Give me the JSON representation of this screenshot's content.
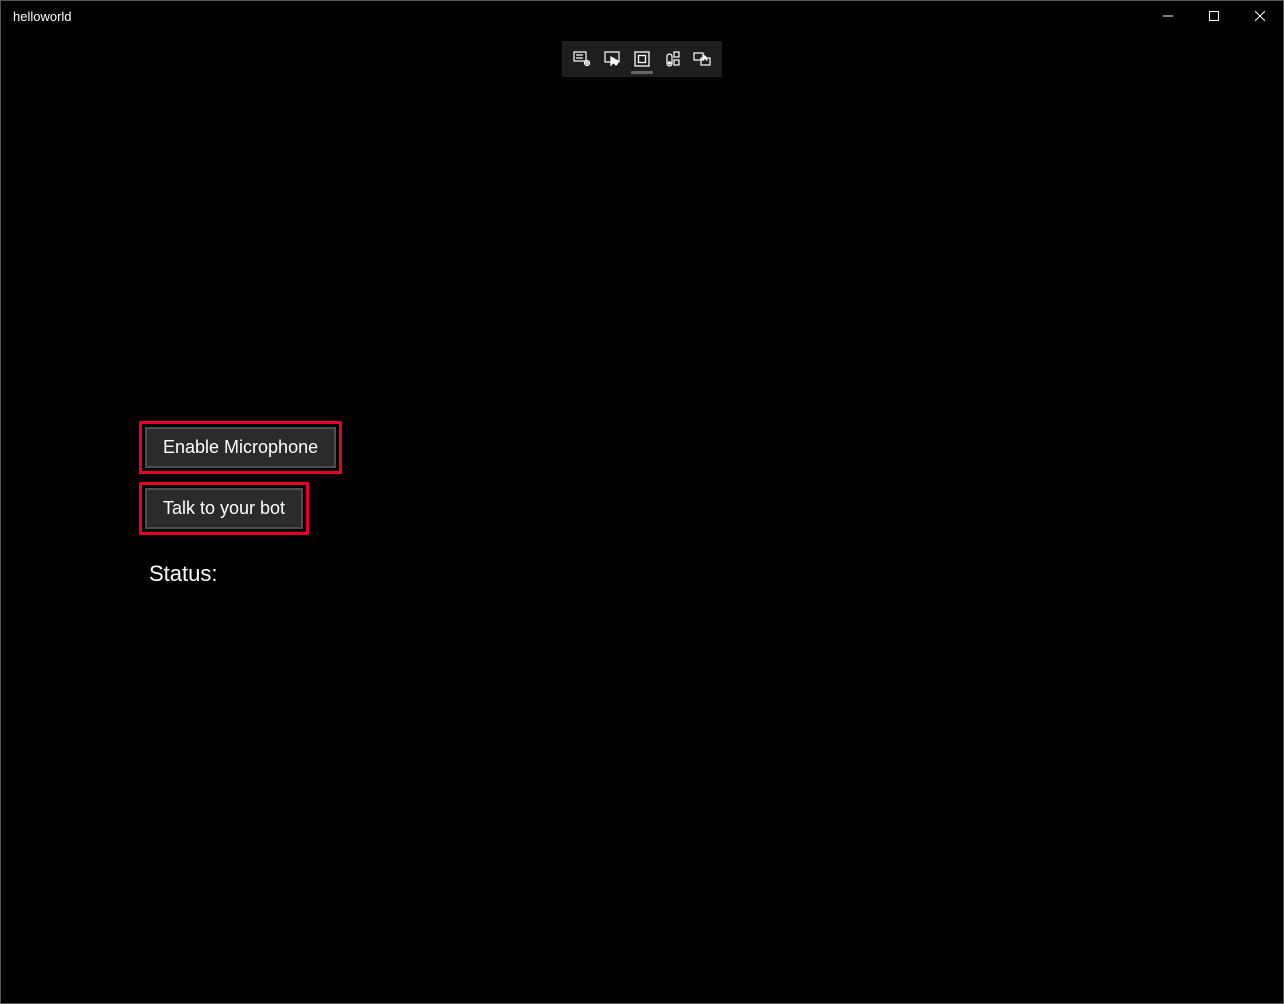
{
  "window": {
    "title": "helloworld"
  },
  "debug_toolbar": {
    "tools": [
      {
        "name": "live-visual-tree"
      },
      {
        "name": "enable-selection"
      },
      {
        "name": "display-layout-adorners"
      },
      {
        "name": "track-focused"
      },
      {
        "name": "go-to-live-visual-tree"
      }
    ]
  },
  "buttons": {
    "enable_mic": "Enable Microphone",
    "talk_bot": "Talk to your bot"
  },
  "status": {
    "label": "Status:"
  }
}
